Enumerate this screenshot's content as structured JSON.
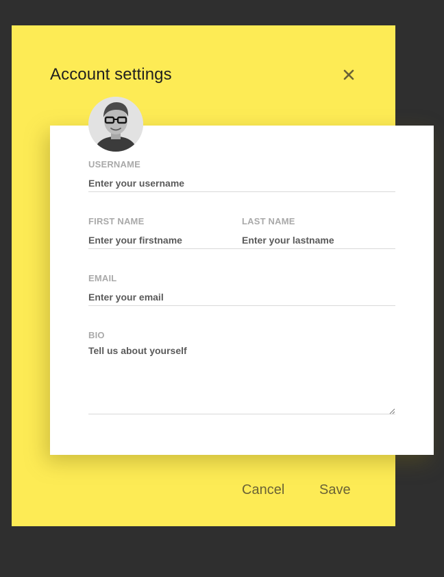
{
  "dialog": {
    "title": "Account settings",
    "close_icon": "close-icon",
    "accent_color": "#fdeb55"
  },
  "avatar": {
    "icon": "user-avatar-photo"
  },
  "form": {
    "username": {
      "label": "USERNAME",
      "placeholder": "Enter your username",
      "value": ""
    },
    "first_name": {
      "label": "FIRST NAME",
      "placeholder": "Enter your firstname",
      "value": ""
    },
    "last_name": {
      "label": "LAST NAME",
      "placeholder": "Enter your lastname",
      "value": ""
    },
    "email": {
      "label": "EMAIL",
      "placeholder": "Enter your email",
      "value": ""
    },
    "bio": {
      "label": "BIO",
      "placeholder": "Tell us about yourself",
      "value": ""
    }
  },
  "actions": {
    "cancel_label": "Cancel",
    "save_label": "Save"
  }
}
